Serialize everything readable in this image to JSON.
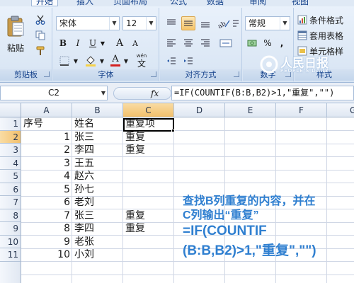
{
  "tabs": [
    "开始",
    "插入",
    "页面布局",
    "公式",
    "数据",
    "审阅",
    "视图"
  ],
  "clipboard": {
    "paste_label": "粘贴",
    "group_label": "剪贴板"
  },
  "font": {
    "font_name": "宋体",
    "font_size": "12",
    "bold": "B",
    "italic": "I",
    "underline": "U",
    "grow": "A",
    "shrink": "A",
    "color_glyph": "A",
    "phonetic": "wén",
    "group_label": "字体"
  },
  "alignment": {
    "group_label": "对齐方式"
  },
  "number": {
    "format": "常规",
    "percent": "%",
    "comma": ",",
    "group_label": "数字"
  },
  "styles": {
    "cond_format": "条件格式",
    "table_format": "套用表格",
    "cell_styles": "单元格样",
    "group_label": "样式"
  },
  "watermark": {
    "brand": "人民日报",
    "sub": "PEOPLE'S DAILY",
    "at": "@"
  },
  "formula_bar": {
    "name_box": "C2",
    "fx": "fx",
    "formula": "=IF(COUNTIF(B:B,B2)>1,\"重复\",\"\")"
  },
  "grid": {
    "columns": [
      "A",
      "B",
      "C",
      "D",
      "E",
      "F",
      "G"
    ],
    "rows": [
      "1",
      "2",
      "3",
      "4",
      "5",
      "6",
      "7",
      "8",
      "9",
      "10",
      "11"
    ],
    "cells": [
      [
        "序号",
        "姓名",
        "重复项"
      ],
      [
        "1",
        "张三",
        "重复"
      ],
      [
        "2",
        "李四",
        "重复"
      ],
      [
        "3",
        "王五",
        ""
      ],
      [
        "4",
        "赵六",
        ""
      ],
      [
        "5",
        "孙七",
        ""
      ],
      [
        "6",
        "老刘",
        ""
      ],
      [
        "7",
        "张三",
        "重复"
      ],
      [
        "8",
        "李四",
        "重复"
      ],
      [
        "9",
        "老张",
        ""
      ],
      [
        "10",
        "小刘",
        ""
      ]
    ]
  },
  "annotation": {
    "line1": "查找B列重复的内容，并在",
    "line2": "C列输出“重复”",
    "line3": "=IF(COUNTIF",
    "line4": "(B:B,B2)>1,\"重复\",\"\")"
  },
  "colors": {
    "accent": "#2f7fd0",
    "ribbon": "#dfe9f5",
    "header_selected": "#f2c06c"
  }
}
